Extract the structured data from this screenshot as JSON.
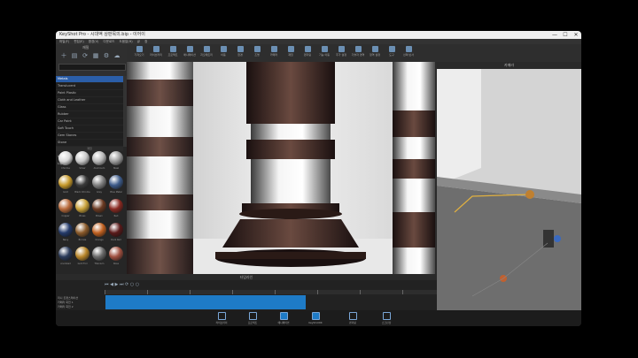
{
  "window": {
    "title": "KeyShot Pro - 시대액 상판목의.bip - 이어이",
    "controls": [
      "—",
      "☐",
      "✕"
    ]
  },
  "menu": [
    "파일(F)",
    "편집(E)",
    "환경(V)",
    "다운로드",
    "도움말(H)",
    "큐",
    "창"
  ],
  "toolbar": [
    {
      "label": "가져오기",
      "icon": "import-icon"
    },
    {
      "label": "라이브러리",
      "icon": "library-icon"
    },
    {
      "label": "프로젝트",
      "icon": "project-icon"
    },
    {
      "label": "애니메이션",
      "icon": "animation-icon"
    },
    {
      "label": "지오메트리",
      "icon": "geometry-icon"
    },
    {
      "label": "이동",
      "icon": "move-icon"
    },
    {
      "label": "환경",
      "icon": "environment-icon"
    },
    {
      "label": "조명",
      "icon": "lighting-icon"
    },
    {
      "label": "카메라",
      "icon": "camera-icon"
    },
    {
      "label": "재질",
      "icon": "material-icon"
    },
    {
      "label": "렌더링",
      "icon": "render-icon"
    },
    {
      "label": "기능 이동",
      "icon": "feature-icon"
    },
    {
      "label": "추가 설정",
      "icon": "settings-icon"
    },
    {
      "label": "기술자 영역",
      "icon": "technician-icon"
    },
    {
      "label": "정역 설정",
      "icon": "region-icon"
    },
    {
      "label": "도구",
      "icon": "tools-icon"
    },
    {
      "label": "선택 반사",
      "icon": "reflection-icon"
    }
  ],
  "library": {
    "title": "재질",
    "list": [
      "Metals",
      "Translucent",
      "Paint Plastic",
      "Cloth and Leather",
      "Glass",
      "Rubber",
      "Car Paint",
      "Soft Touch",
      "Gem Stones",
      "Stone",
      "Liquids",
      "Wood",
      "Lights"
    ],
    "selected_index": 0,
    "swatch_header": "재질",
    "swatches": [
      {
        "name": "Chrome",
        "color": "#d8d8d8"
      },
      {
        "name": "Silver",
        "color": "#c8c8c8"
      },
      {
        "name": "Aluminum",
        "color": "#b8b8b8"
      },
      {
        "name": "Steel",
        "color": "#9c9c9c"
      },
      {
        "name": "Gold",
        "color": "#c79a2b"
      },
      {
        "name": "Black Chrome",
        "color": "#3a3a3a"
      },
      {
        "name": "Grey",
        "color": "#808080"
      },
      {
        "name": "Blue Metal",
        "color": "#3d5b8a"
      },
      {
        "name": "Copper",
        "color": "#b86a3a"
      },
      {
        "name": "Brass",
        "color": "#c9a23a"
      },
      {
        "name": "Brown",
        "color": "#6b3a22"
      },
      {
        "name": "Red",
        "color": "#8a2a22"
      },
      {
        "name": "Navy",
        "color": "#243a6a"
      },
      {
        "name": "Bronze",
        "color": "#8a5a2a"
      },
      {
        "name": "Orange",
        "color": "#c06020"
      },
      {
        "name": "Dark Red",
        "color": "#5a1a1a"
      },
      {
        "name": "Anodized",
        "color": "#2a3a5a"
      },
      {
        "name": "Gold Foil",
        "color": "#b8862a"
      },
      {
        "name": "Titanium",
        "color": "#6a6a6a"
      },
      {
        "name": "Rose",
        "color": "#a05040"
      }
    ]
  },
  "inset": {
    "title": "카메라"
  },
  "timeline": {
    "title": "타임라인",
    "labels": [
      "미니 트랜스레이션",
      "카메라 회전 1",
      "카메라 회전 2"
    ],
    "controls": "⏮ ◀ ▶ ⏭ ⟳ ○ ○"
  },
  "bottombar": [
    {
      "label": "라이브러리",
      "icon": "library-icon",
      "active": false
    },
    {
      "label": "프로젝트",
      "icon": "project-icon",
      "active": false
    },
    {
      "label": "애니메이션",
      "icon": "animation-icon",
      "active": true
    },
    {
      "label": "KeyShotXR",
      "icon": "keyshotxr-icon",
      "active": true
    },
    {
      "label": "렌더링",
      "icon": "render-icon",
      "active": false
    },
    {
      "label": "스크린샷",
      "icon": "screenshot-icon",
      "active": false
    }
  ],
  "colors": {
    "accent": "#1e7bc7",
    "selection": "#2b5ea8"
  }
}
